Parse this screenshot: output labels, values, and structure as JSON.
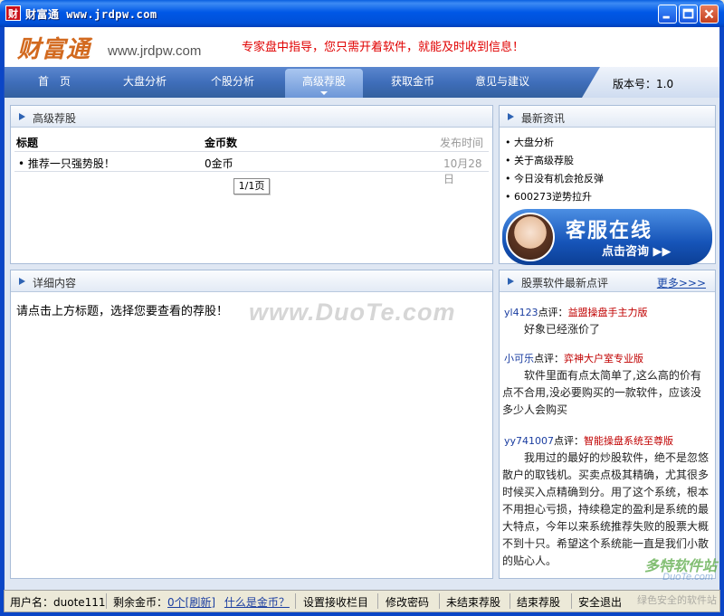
{
  "window": {
    "title": "财富通 www.jrdpw.com",
    "icon_text": "财"
  },
  "header": {
    "logo_cn": "财富通",
    "logo_url": "www.jrdpw.com",
    "slogan": "专家盘中指导，您只需开着软件，就能及时收到信息！"
  },
  "nav": {
    "items": [
      {
        "label": "首　页"
      },
      {
        "label": "大盘分析"
      },
      {
        "label": "个股分析"
      },
      {
        "label": "高级荐股",
        "active": true
      },
      {
        "label": "获取金币"
      },
      {
        "label": "意见与建议"
      }
    ],
    "version": "版本号：1.0"
  },
  "recommend": {
    "title": "高级荐股",
    "columns": [
      "标题",
      "金币数",
      "发布时间"
    ],
    "rows": [
      {
        "title": "• 推荐一只强势股！",
        "coins": "0金币",
        "date": "10月28日"
      }
    ],
    "pager": "1/1页"
  },
  "detail": {
    "title": "详细内容",
    "text": "请点击上方标题，选择您要查看的荐股！",
    "watermark": "www.DuoTe.com"
  },
  "news": {
    "title": "最新资讯",
    "items": [
      "• 大盘分析",
      "• 关于高级荐股",
      "• 今日没有机会抢反弹",
      "• 600273逆势拉升"
    ]
  },
  "service": {
    "title": "客服在线",
    "subtitle": "点击咨询 ▶▶"
  },
  "comments": {
    "title": "股票软件最新点评",
    "more": "更多>>>",
    "items": [
      {
        "user": "yl4123",
        "label": "点评：",
        "product": "益盟操盘手主力版",
        "text": "好象已经涨价了"
      },
      {
        "user": "小可乐",
        "label": "点评：",
        "product": "弈神大户室专业版",
        "text": "软件里面有点太简单了,这么高的价有点不合用,没必要购买的一款软件，应该没多少人会购买"
      },
      {
        "user": "yy741007",
        "label": "点评：",
        "product": "智能操盘系统至尊版",
        "text": "我用过的最好的炒股软件，绝不是忽悠散户的取钱机。买卖点极其精确，尤其很多时候买入点精确到分。用了这个系统，根本不用担心亏损，持续稳定的盈利是系统的最大特点，今年以来系统推荐失败的股票大概不到十只。希望这个系统能一直是我们小散的贴心人。"
      }
    ]
  },
  "status": {
    "username": "用户名：duote111",
    "coins_label": "剩余金币：",
    "coins_value": "0个",
    "refresh": "[刷新]",
    "what_coin": "什么是金币？",
    "settings": "设置接收栏目",
    "change_pw": "修改密码",
    "unfinished": "未结束荐股",
    "finished": "结束荐股",
    "logout": "安全退出"
  },
  "corner_watermark": {
    "line1": "多特软件站",
    "line2": "DuoTe.com",
    "line3": "绿色安全的软件站"
  }
}
